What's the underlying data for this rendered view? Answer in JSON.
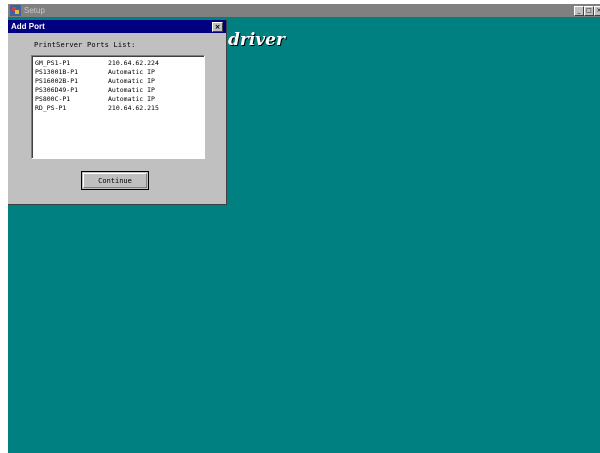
{
  "setup_window": {
    "title": "Setup",
    "banner": "driver",
    "minimize": "_",
    "maximize": "□",
    "close": "×"
  },
  "dialog": {
    "title": "Add Port",
    "close": "×",
    "list_caption": "PrintServer Ports List:",
    "ports": [
      {
        "name": "GM_PS1-P1",
        "address": "210.64.62.224"
      },
      {
        "name": "PS13001B-P1",
        "address": "Automatic IP"
      },
      {
        "name": "PS16002B-P1",
        "address": "Automatic IP"
      },
      {
        "name": "PS306D49-P1",
        "address": "Automatic IP"
      },
      {
        "name": "PS800C-P1",
        "address": "Automatic IP"
      },
      {
        "name": "RD_PS-P1",
        "address": "210.64.62.215"
      }
    ],
    "continue_label": "Continue"
  },
  "colors": {
    "desktop": "#008080",
    "dialog_titlebar": "#000080",
    "window_face": "#c0c0c0"
  }
}
